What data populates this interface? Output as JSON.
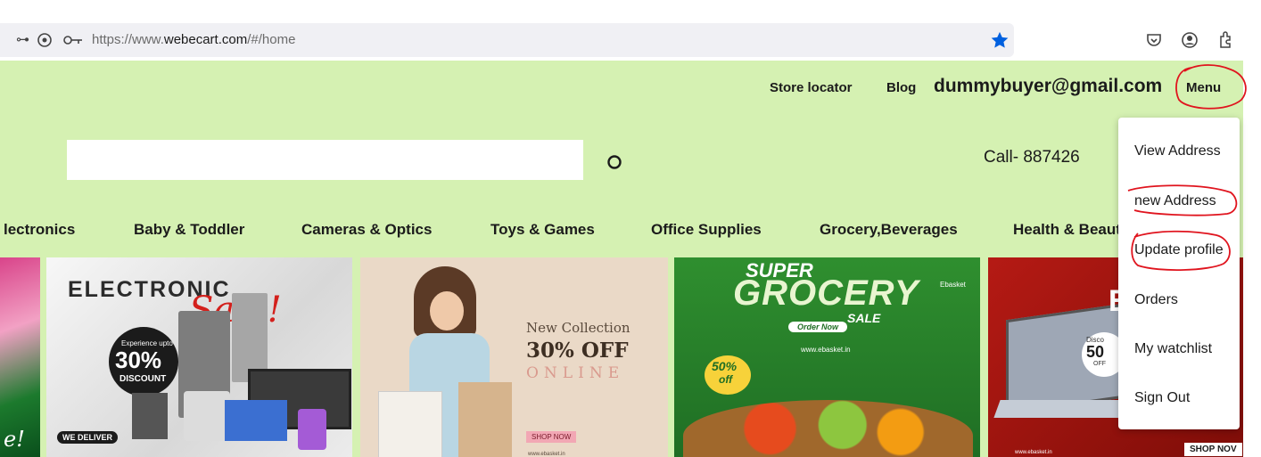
{
  "browser": {
    "url_prefix": "https://www.",
    "url_domain": "webecart.com",
    "url_path": "/#/home",
    "icons": [
      "tracking-shield-icon",
      "location-icon",
      "key-icon",
      "bookmark-star-icon",
      "pocket-icon",
      "account-icon",
      "extensions-icon"
    ],
    "star_color": "#0060df"
  },
  "header": {
    "store_locator": "Store locator",
    "blog": "Blog",
    "user_email": "dummybuyer@gmail.com",
    "menu_label": "Menu"
  },
  "search": {
    "placeholder": "",
    "icon": "search-icon"
  },
  "call_text": "Call- 887426",
  "categories": [
    "lectronics",
    "Baby & Toddler",
    "Cameras & Optics",
    "Toys & Games",
    "Office Supplies",
    "Grocery,Beverages",
    "Health & Beaut"
  ],
  "banners": {
    "electronic": {
      "title": "ELECTRONIC",
      "script": "Sale!",
      "promo_small": "Experience upto",
      "percent": "30%",
      "discount": "DISCOUNT",
      "badge": "WE DELIVER"
    },
    "fashion": {
      "line1": "New Collection",
      "line2": "30% OFF",
      "line3": "ONLINE",
      "button": "SHOP NOW",
      "footer": "www.ebasket.in"
    },
    "grocery": {
      "super": "SUPER",
      "grocery": "GROCERY",
      "sale": "SALE",
      "brand": "Ebasket",
      "order_now": "Order Now",
      "site": "www.ebasket.in",
      "percent": "50%",
      "off": "off"
    },
    "laptop": {
      "big": "EI",
      "disc": "Disco",
      "percent": "50",
      "off": "OFF",
      "site": "www.ebasket.in",
      "shop": "SHOP NOV"
    }
  },
  "menu_dropdown": {
    "items": [
      "View Address",
      "new Address",
      "Update profile",
      "Orders",
      "My watchlist",
      "Sign Out"
    ]
  },
  "annotation_color": "#e0141e",
  "colors": {
    "page_bg": "#d5f1b2",
    "address_bar": "#f0f0f4"
  }
}
